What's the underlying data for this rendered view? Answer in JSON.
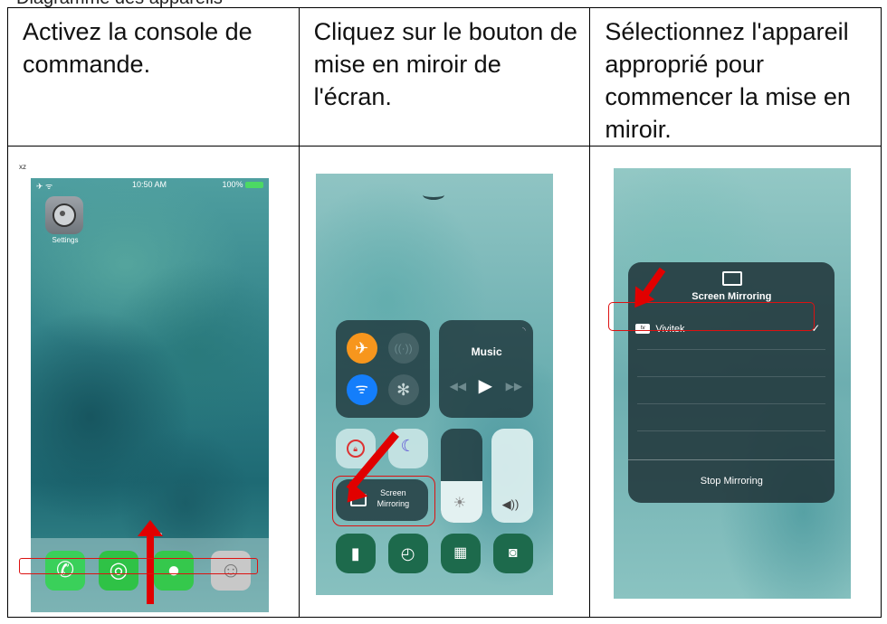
{
  "cut_top_text": "Diagramme des appareils",
  "columns": [
    {
      "header": "Activez la console de commande."
    },
    {
      "header": "Cliquez sur le bouton de mise en miroir de l'écran."
    },
    {
      "header": "Sélectionnez l'appareil approprié pour commencer la mise en miroir."
    }
  ],
  "phone1": {
    "corner_label": "xz",
    "time": "10:50 AM",
    "battery": "100%",
    "app_label": "Settings"
  },
  "phone2": {
    "music_label": "Music",
    "screen_mirroring_label_line1": "Screen",
    "screen_mirroring_label_line2": "Mirroring"
  },
  "phone3": {
    "panel_title": "Screen Mirroring",
    "device_badge": "tv",
    "device_name": "Vivitek",
    "stop_label": "Stop Mirroring"
  },
  "colors": {
    "accent_red": "#e10000",
    "ios_orange": "#f7961d",
    "ios_blue": "#147efb",
    "ios_green": "#3ad05a"
  }
}
